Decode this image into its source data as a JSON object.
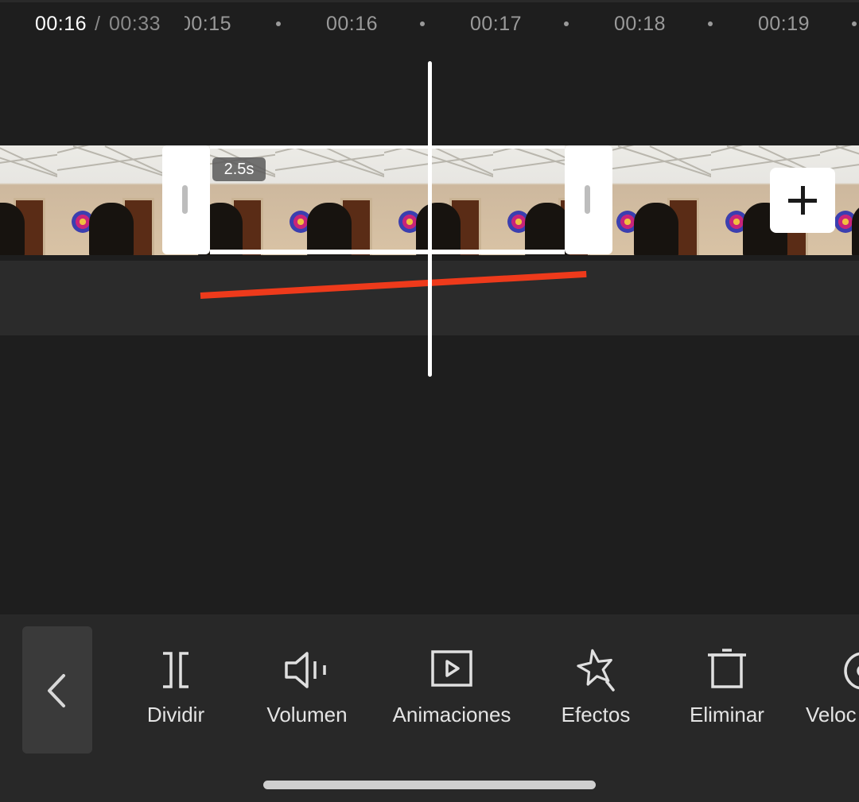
{
  "timeline": {
    "current_time": "00:16",
    "separator": "/",
    "total_time": "00:33",
    "ticks": [
      "00:15",
      "00:16",
      "00:17",
      "00:18",
      "00:19"
    ]
  },
  "clip": {
    "duration_label": "2.5s"
  },
  "icons": {
    "add": "plus-icon",
    "back": "chevron-left-icon"
  },
  "colors": {
    "background": "#1e1e1e",
    "toolbar": "#282828",
    "annotation_line": "#ee3a1b",
    "playhead": "#ffffff"
  },
  "toolbar": {
    "tools": [
      {
        "label": "Dividir",
        "icon": "split-icon"
      },
      {
        "label": "Volumen",
        "icon": "volume-icon"
      },
      {
        "label": "Animaciones",
        "icon": "animation-play-icon"
      },
      {
        "label": "Efectos",
        "icon": "effects-star-icon"
      },
      {
        "label": "Eliminar",
        "icon": "delete-icon"
      },
      {
        "label": "Veloc",
        "icon": "speed-icon"
      }
    ]
  }
}
